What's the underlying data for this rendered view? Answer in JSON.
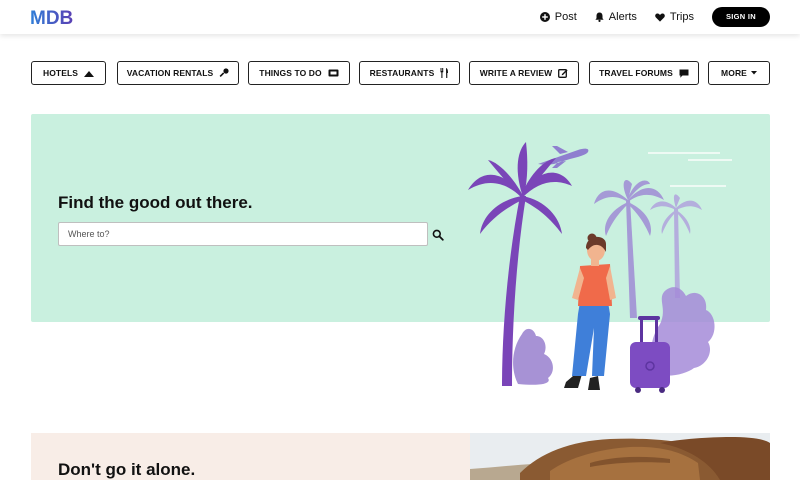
{
  "brand": {
    "logo_text": "MDB"
  },
  "nav": {
    "post_label": "Post",
    "alerts_label": "Alerts",
    "trips_label": "Trips",
    "signin_label": "SIGN IN"
  },
  "categories": [
    {
      "label": "HOTELS",
      "icon": "hotel-bed-icon"
    },
    {
      "label": "VACATION RENTALS",
      "icon": "key-icon"
    },
    {
      "label": "THINGS TO DO",
      "icon": "ticket-icon"
    },
    {
      "label": "RESTAURANTS",
      "icon": "utensils-icon"
    },
    {
      "label": "WRITE A REVIEW",
      "icon": "edit-icon"
    },
    {
      "label": "TRAVEL FORUMS",
      "icon": "comment-icon"
    },
    {
      "label": "MORE",
      "icon": "caret-down-icon"
    }
  ],
  "hero": {
    "title": "Find the good out there.",
    "search_placeholder": "Where to?"
  },
  "section2": {
    "title": "Don't go it alone."
  },
  "colors": {
    "hero_bg": "#c9f0df",
    "palm_dark": "#7a45b8",
    "palm_light": "#a59ad6",
    "shirt": "#f06a4a",
    "suitcase": "#7d4cc2",
    "section2_bg": "#f8ede7"
  }
}
